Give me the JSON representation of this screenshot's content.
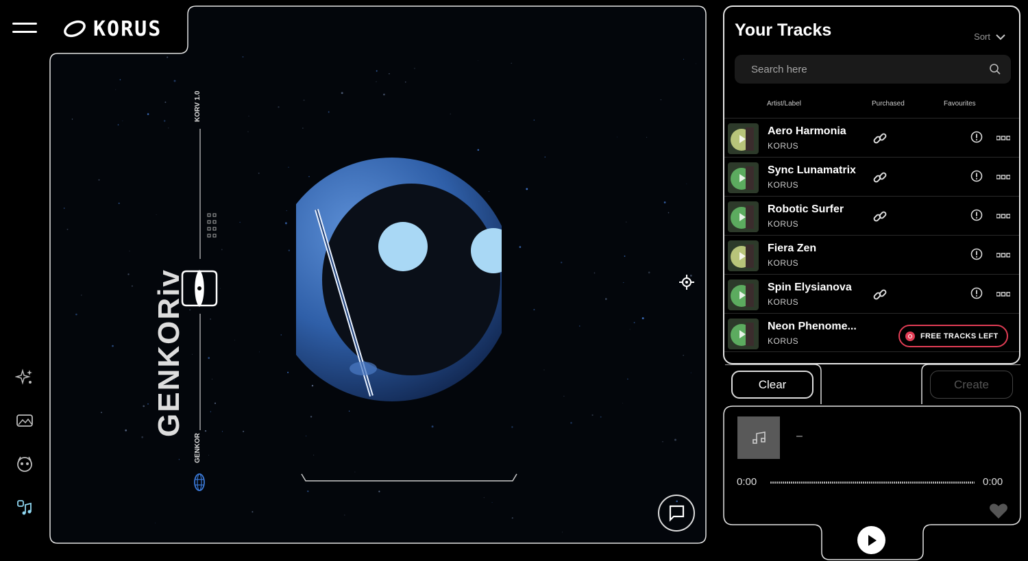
{
  "app": {
    "logo_text": "KORUS"
  },
  "stage": {
    "vertical_title": "GENKORiv",
    "vertical_small_top": "KORV 1.0",
    "vertical_small_bottom": "GENKOR"
  },
  "tracks_panel": {
    "title": "Your Tracks",
    "sort_label": "Sort",
    "search_placeholder": "Search here",
    "columns": {
      "artist_label": "Artist/Label",
      "purchased": "Purchased",
      "favourites": "Favourites"
    },
    "tracks": [
      {
        "title": "Aero Harmonia",
        "label": "KORUS",
        "purchased": true
      },
      {
        "title": "Sync Lunamatrix",
        "label": "KORUS",
        "purchased": true
      },
      {
        "title": "Robotic Surfer",
        "label": "KORUS",
        "purchased": true
      },
      {
        "title": "Fiera Zen",
        "label": "KORUS",
        "purchased": false
      },
      {
        "title": "Spin Elysianova",
        "label": "KORUS",
        "purchased": true
      },
      {
        "title": "Neon Phenome...",
        "label": "KORUS",
        "purchased": false
      }
    ],
    "free_tracks_badge": "FREE TRACKS LEFT"
  },
  "actions": {
    "clear_label": "Clear",
    "create_label": "Create"
  },
  "player": {
    "track_name": "–",
    "time_current": "0:00",
    "time_total": "0:00",
    "progress": 0
  },
  "colors": {
    "accent_red": "#e23d55",
    "robot_blue": "#2f5fa8",
    "eye": "#a9d8f5",
    "sidebar_active": "#8fd6f0"
  },
  "icons": {
    "sidebar": [
      "sparkles-icon",
      "image-icon",
      "robot-face-icon",
      "music-generate-icon"
    ],
    "misc": [
      "hamburger-icon",
      "crosshair-icon",
      "chat-icon",
      "globe-icon",
      "search-icon",
      "chevron-down-icon",
      "link-icon",
      "alert-icon",
      "more-icon",
      "heart-icon",
      "play-icon",
      "music-note-icon"
    ]
  }
}
